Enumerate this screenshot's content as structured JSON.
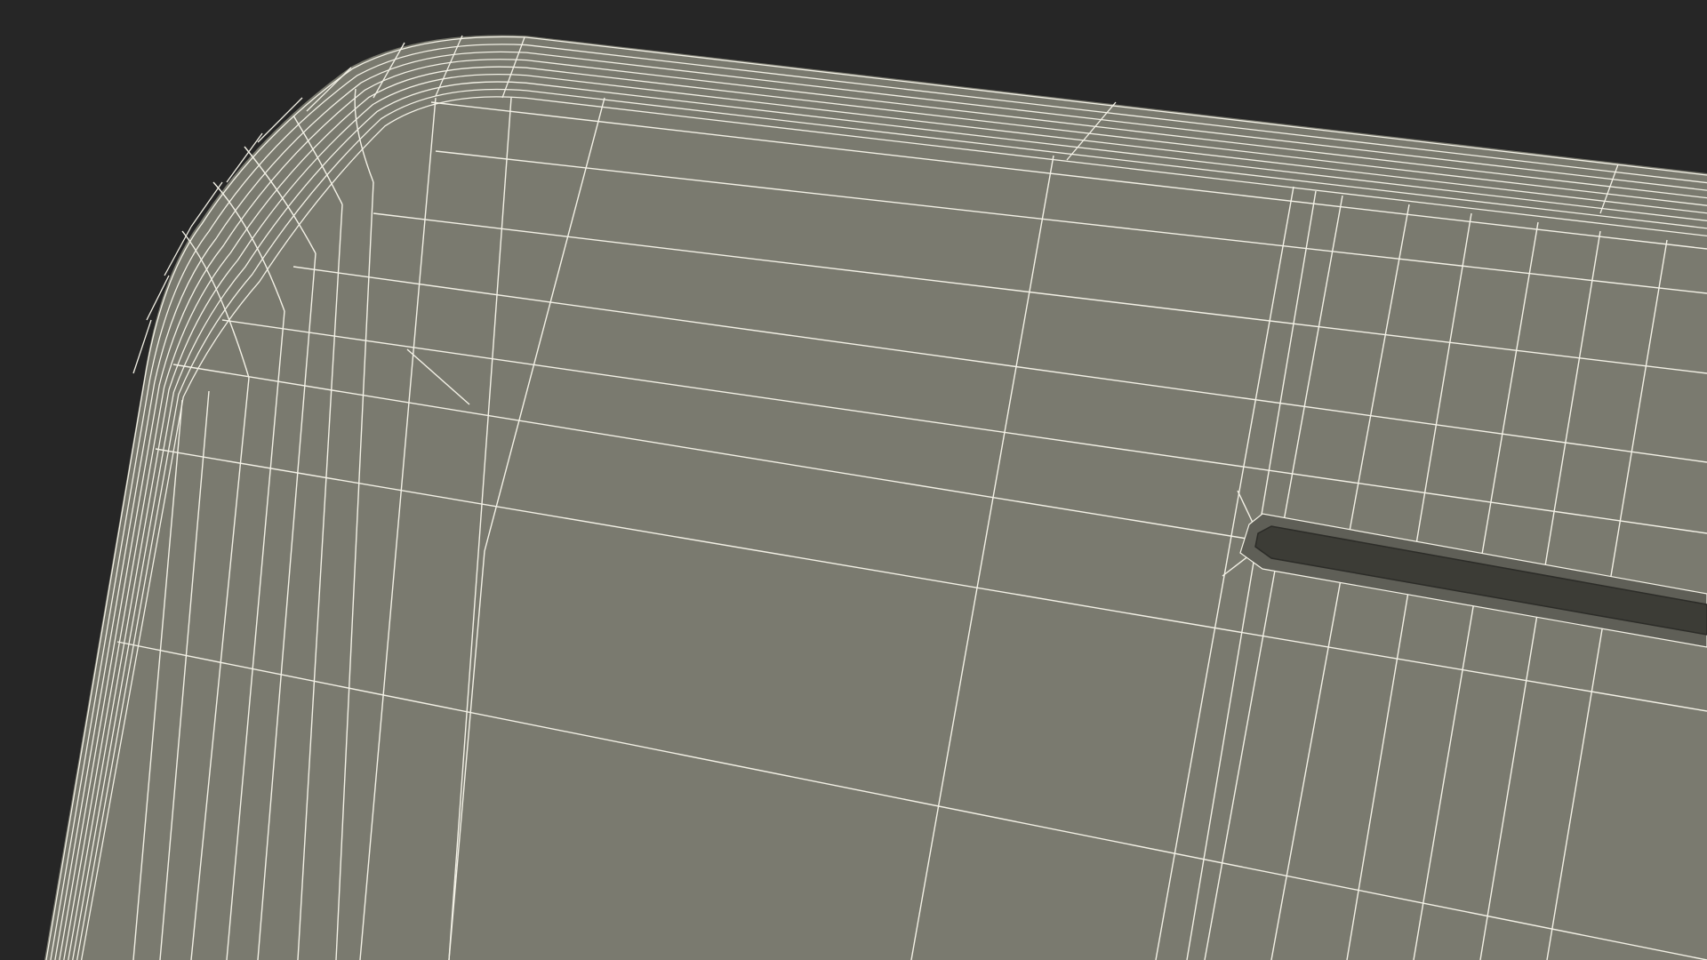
{
  "scene": {
    "background_color": "#262626",
    "surface_color": "#7a7a6f",
    "wire_color": "#f3f1e6",
    "slot_color": "#3c3c36",
    "view_mode": "wireframe-on-shaded"
  }
}
